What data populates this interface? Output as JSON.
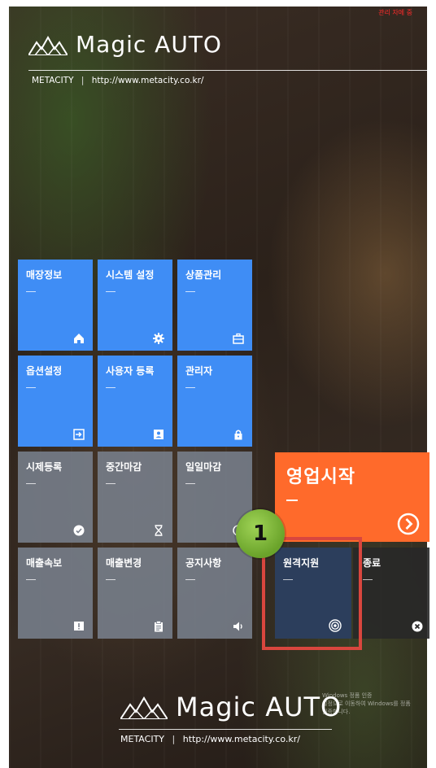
{
  "top_note": "관리 자메 중",
  "brand": {
    "name": "Magic AUTO",
    "company": "METACITY",
    "separator": "|",
    "url": "http://www.metacity.co.kr/"
  },
  "tiles": {
    "store_info": "매장정보",
    "system_settings": "시스템 설정",
    "product_mgmt": "상품관리",
    "option_settings": "옵션설정",
    "user_register": "사용자 등록",
    "admin": "관리자",
    "clock_in": "시제등록",
    "mid_close": "중간마감",
    "daily_close": "일일마감",
    "sales_report": "매출속보",
    "sales_change": "매출변경",
    "notice": "공지사항",
    "remote_support": "원격지원",
    "exit": "종료",
    "start_business": "영업시작"
  },
  "callout_number": "1",
  "windows_notice": {
    "line1": "Windows 정품 인증",
    "line2": "설정으로 이동하여 Windows를 정품",
    "line3": "인증합니다."
  },
  "colors": {
    "blue": "#3f8df5",
    "orange": "#ff6a2b",
    "gray": "#7a808c",
    "navy": "#2c3e5c",
    "highlight": "#d9463e",
    "badge": "#8cc63f"
  }
}
